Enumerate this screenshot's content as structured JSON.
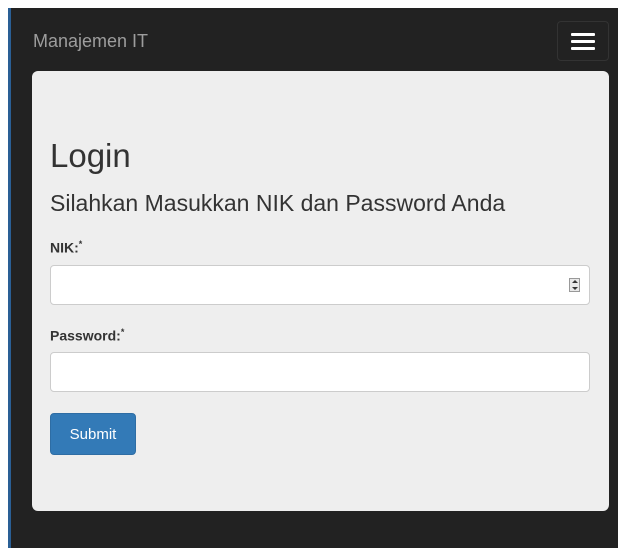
{
  "navbar": {
    "brand": "Manajemen IT",
    "toggle_icon": "hamburger-menu-icon"
  },
  "form": {
    "title": "Login",
    "subtitle": "Silahkan Masukkan NIK dan Password Anda",
    "nik_label": "NIK:",
    "nik_required_mark": "*",
    "nik_value": "",
    "password_label": "Password:",
    "password_required_mark": "*",
    "password_value": "",
    "submit_label": "Submit"
  },
  "colors": {
    "navbar_bg": "#222222",
    "brand_text": "#9d9d9d",
    "panel_bg": "#eeeeee",
    "primary_button": "#337ab7"
  }
}
